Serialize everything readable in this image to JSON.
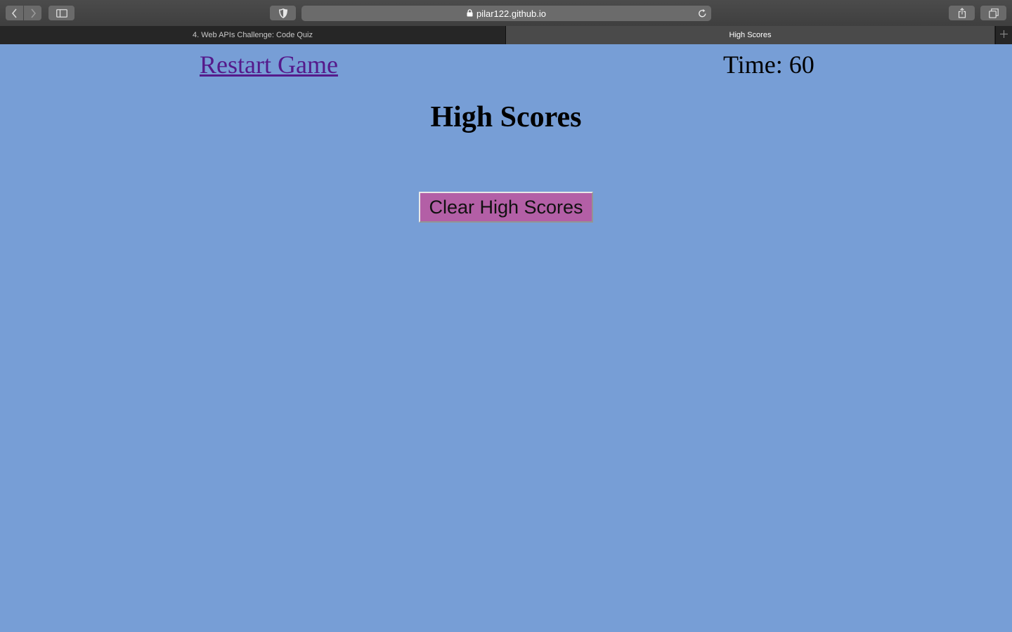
{
  "browser": {
    "url": "pilar122.github.io",
    "tabs": [
      {
        "label": "4. Web APIs Challenge: Code Quiz",
        "active": false
      },
      {
        "label": "High Scores",
        "active": true
      }
    ],
    "icons": {
      "back": "chevron-left-icon",
      "forward": "chevron-right-icon",
      "sidebar": "sidebar-icon",
      "privacy": "shield-icon",
      "lock": "lock-icon",
      "reload": "reload-icon",
      "share": "share-icon",
      "tabs": "tab-overview-icon",
      "new_tab": "plus-icon"
    }
  },
  "page": {
    "restart_label": "Restart Game",
    "timer_text": "Time: 60",
    "title": "High Scores",
    "clear_label": "Clear High Scores"
  },
  "colors": {
    "page_background": "#779ed6",
    "button_background": "#b35fa6",
    "visited_link": "#551a8b"
  }
}
